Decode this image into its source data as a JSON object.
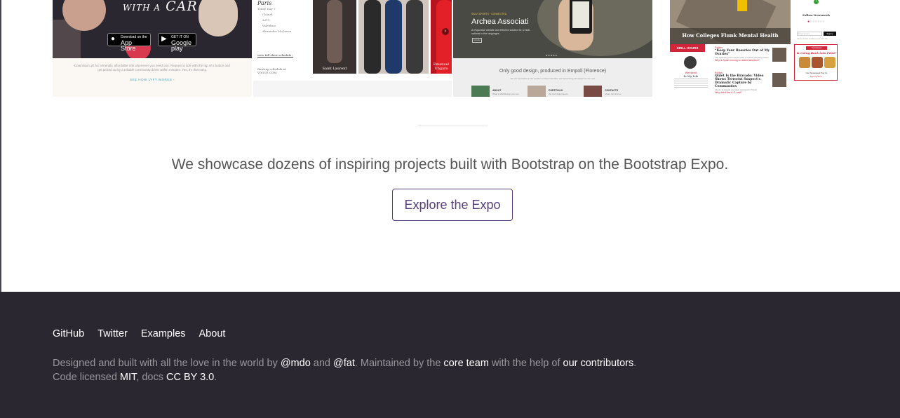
{
  "showcase": {
    "lyft": {
      "tagline_small": "WITH A",
      "tagline_big": "CAR",
      "app_store_small": "Download on the",
      "app_store": "App Store",
      "google_play_small": "GET IT ON",
      "google_play": "Google play",
      "copy": "Download Lyft for a friendly, affordable ride whenever you need one. Request a ride with the tap of a button and get picked up by a reliable community driver within minutes. Yes, it's that easy.",
      "cta": "SEE HOW LYFT WORKS ›"
    },
    "vogue": {
      "city": "Paris",
      "subnav_head": "Today, Day 7",
      "subnav_items": [
        "Chanel",
        "A.P.C.",
        "Valentino",
        "Alexander McQueen"
      ],
      "link": "view full show schedule ›",
      "tags": "Runway schedule at VOGUE.COM",
      "captions": [
        "Saint Laurent",
        "Emanuel Ungaro"
      ]
    },
    "archea": {
      "eyebrow": "SALVI SPORTS · CONNECTED",
      "name": "Archea Associati",
      "desc": "A responsive website and effective solution for a multi-national in five languages.",
      "button": "Details",
      "tagline": "Only good design, produced in Empoli (Florence)",
      "tagsub": "We are specialists in the creation of brand identities and advertising campaigns for the web",
      "cards": [
        {
          "title": "ABOUT",
          "text": "What is WebDesign you can"
        },
        {
          "title": "PORTFOLIO",
          "text": "the best digi-projects"
        },
        {
          "title": "CONTACTS",
          "text": "where can find us"
        }
      ]
    },
    "news": {
      "hero_title": "How Colleges Flunk Mental Health",
      "section": "DRILL HOURS",
      "col_head": "Weekend",
      "col_title": "In My Life",
      "stories": [
        {
          "kick": "Politics",
          "head": "“Keep Your Rosaries Out of My Ovaries”",
          "text": "The Spanish government's plan to restrict abortions faces",
          "more": "Why is Spain moving to restrict abortion?"
        },
        {
          "kick": "Politics",
          "head": "Quiet Is the Bravado: Video Shows Terrorist Suspect's Dramatic Capture by Commandos",
          "text": "Libyan al-Qaeda operative captured in Tripoli",
          "more": "Why didn't the U.S. wait?"
        }
      ],
      "follow": "Follow Newsweek",
      "email_placeholder": "Enter Email",
      "signup": "Signup",
      "fine": "Get top stories emailed to you each day.",
      "ad_head": "Newsweek",
      "ad_title": "Is Going Back into Print?",
      "ad_text": "Can Newsweek Pay Its",
      "ad_link": "Sign up here ›"
    }
  },
  "expo": {
    "lead": "We showcase dozens of inspiring projects built with Bootstrap on the Bootstrap Expo.",
    "button": "Explore the Expo"
  },
  "footer": {
    "links": [
      "GitHub",
      "Twitter",
      "Examples",
      "About"
    ],
    "line1": {
      "pre": "Designed and built with all the love in the world by ",
      "mdo": "@mdo",
      "and": " and ",
      "fat": "@fat",
      "mid": ". Maintained by the ",
      "core": "core team",
      "help": " with the help of ",
      "contrib": "our contributors",
      "end": "."
    },
    "line2": {
      "pre": "Code licensed ",
      "mit": "MIT",
      "docs": ", docs ",
      "cc": "CC BY 3.0",
      "end": "."
    }
  },
  "colors": {
    "brand_purple": "#563d7c",
    "footer_bg": "#2a2730",
    "footer_muted": "#99979c"
  }
}
